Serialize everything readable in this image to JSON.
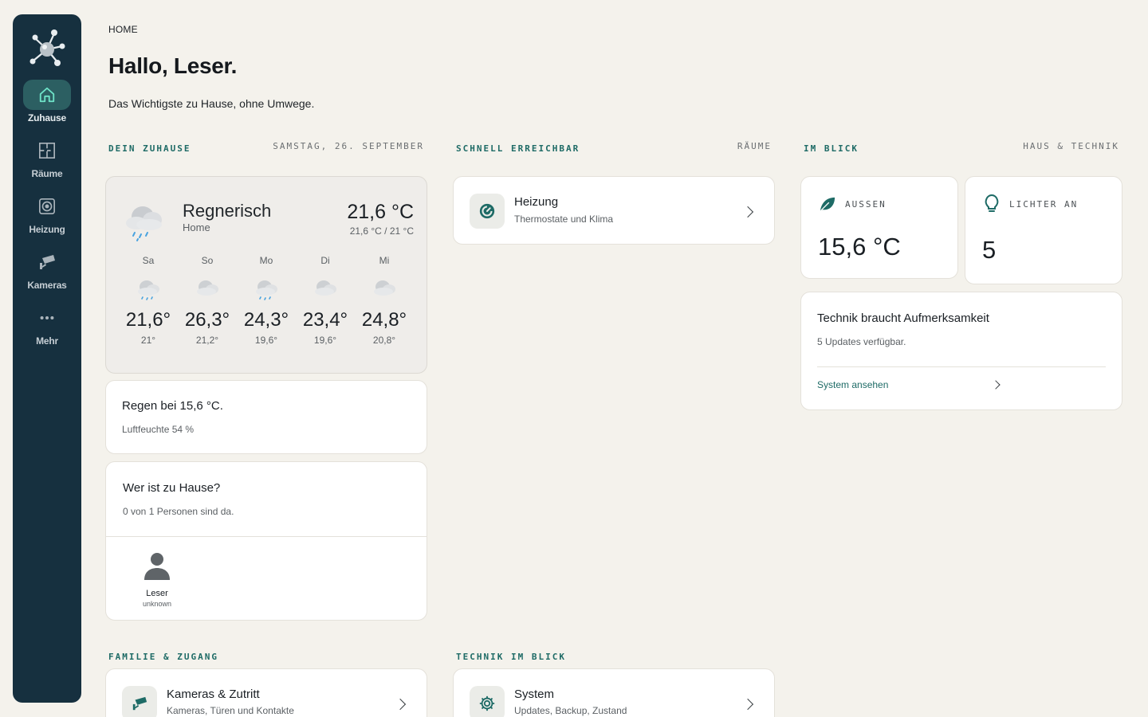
{
  "sidebar": {
    "logo": "network-logo",
    "items": [
      {
        "label": "Zuhause",
        "icon": "home-icon"
      },
      {
        "label": "Räume",
        "icon": "floorplan-icon"
      },
      {
        "label": "Heizung",
        "icon": "heater-icon"
      },
      {
        "label": "Kameras",
        "icon": "cctv-icon"
      },
      {
        "label": "Mehr",
        "icon": "more-icon"
      }
    ]
  },
  "header": {
    "breadcrumb": "HOME",
    "title": "Hallo, Leser.",
    "subtitle": "Das Wichtigste zu Hause, ohne Umwege."
  },
  "sections": {
    "zuhause": {
      "title": "DEIN ZUHAUSE",
      "meta": "SAMSTAG, 26. SEPTEMBER"
    },
    "schnell": {
      "title": "SCHNELL ERREICHBAR",
      "meta": "RÄUME"
    },
    "blick": {
      "title": "IM BLICK",
      "meta": "HAUS & TECHNIK"
    },
    "familie": {
      "title": "FAMILIE & ZUGANG"
    },
    "technik": {
      "title": "TECHNIK IM BLICK"
    }
  },
  "weather": {
    "condition": "Regnerisch",
    "location": "Home",
    "temperature": "21,6 °C",
    "range": "21,6 °C / 21 °C",
    "forecast": [
      {
        "day": "Sa",
        "high": "21,6°",
        "low": "21°",
        "icon": "rain-cloud-icon"
      },
      {
        "day": "So",
        "high": "26,3°",
        "low": "21,2°",
        "icon": "cloud-icon"
      },
      {
        "day": "Mo",
        "high": "24,3°",
        "low": "19,6°",
        "icon": "rain-cloud-icon"
      },
      {
        "day": "Di",
        "high": "23,4°",
        "low": "19,6°",
        "icon": "cloud-icon"
      },
      {
        "day": "Mi",
        "high": "24,8°",
        "low": "20,8°",
        "icon": "cloud-icon"
      }
    ]
  },
  "rain": {
    "title": "Regen bei 15,6 °C.",
    "humidity": "Luftfeuchte 54 %"
  },
  "presence": {
    "title": "Wer ist zu Hause?",
    "summary": "0 von 1 Personen sind da.",
    "persons": [
      {
        "name": "Leser",
        "state": "unknown"
      }
    ]
  },
  "quick": {
    "heizung": {
      "title": "Heizung",
      "sub": "Thermostate und Klima"
    }
  },
  "stats": {
    "aussen": {
      "label": "AUSSEN",
      "value": "15,6 °C"
    },
    "lichter": {
      "label": "LICHTER AN",
      "value": "5"
    }
  },
  "technik_card": {
    "title": "Technik braucht Aufmerksamkeit",
    "sub": "5 Updates verfügbar.",
    "link": "System ansehen"
  },
  "familie_card": {
    "title": "Kameras & Zutritt",
    "sub": "Kameras, Türen und Kontakte"
  },
  "system_card": {
    "title": "System",
    "sub": "Updates, Backup, Zustand"
  },
  "colors": {
    "sidebar": "#16303f",
    "accent": "#1e6b66",
    "background": "#f4f2ec",
    "active_nav": "#2c5f62"
  }
}
